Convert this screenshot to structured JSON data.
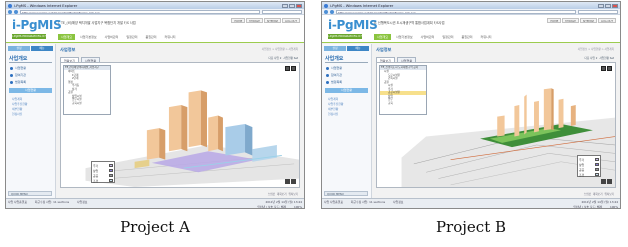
{
  "captions": [
    "Project A",
    "Project B"
  ],
  "browser": {
    "title": "i-PgMS - Windows Internet Explorer",
    "url": "http://www.pgms.net/main/ikimfind/mframe_list.asp"
  },
  "app": {
    "logo": "i-PgMIS",
    "logo_sub": "i-PgMS PROGRAM EG 07",
    "top_links": [
      "HOME",
      "MYPAGE",
      "SITEMAP",
      "LOG-OUT"
    ],
    "nav": [
      "사업개요",
      "사업기본정보",
      "사업비관리",
      "일정관리",
      "품질관리",
      "커뮤니티"
    ]
  },
  "sidebar": {
    "tabs": [
      "설정",
      "메뉴"
    ],
    "heading": "사업개요",
    "links": [
      "사업현황",
      "참여기관",
      "법령목록"
    ],
    "button": "사업현황",
    "subs": [
      "사업계획",
      "사업추진현황",
      "세부현황",
      "현장사진"
    ],
    "quick_menu": "QUICK MENU"
  },
  "panels": [
    {
      "project_title": "I. TE_(비)해양 택지개발 사업지구 복합단지 개발 F/S 사업",
      "page_heading": "사업정보",
      "breadcrumb": "사업정보 > 사업현황 > 사업계획",
      "sub_tabs": [
        "현황보기",
        "사업현황"
      ],
      "toolbar_right": [
        "다음 사업 2",
        "사업현황 Set"
      ],
      "tree_title": "TE_(비)해양택지개발_사업지구",
      "tree": [
        {
          "label": "아파트",
          "level": 1,
          "hl": false
        },
        {
          "label": "1단계",
          "level": 2,
          "hl": false
        },
        {
          "label": "2단계",
          "level": 2,
          "hl": false
        },
        {
          "label": "행정",
          "level": 1,
          "hl": false
        },
        {
          "label": "주거동",
          "level": 2,
          "hl": false
        },
        {
          "label": "상가",
          "level": 2,
          "hl": false
        },
        {
          "label": "공원",
          "level": 1,
          "hl": false
        },
        {
          "label": "상업시설",
          "level": 2,
          "hl": false
        },
        {
          "label": "업무시설",
          "level": 2,
          "hl": false
        },
        {
          "label": "교육시설",
          "level": 2,
          "hl": false
        }
      ],
      "legend": [
        {
          "label": "주거",
          "color": "#c6b8e3"
        },
        {
          "label": "상업",
          "color": "#8c7fd6"
        },
        {
          "label": "공공",
          "color": "#9b9b9b"
        },
        {
          "label": "조경",
          "color": "#c8e0ef"
        }
      ],
      "view_footer": [
        "스냅샷",
        "대화보기",
        "위치보기"
      ],
      "status_left": "사업 사업총괄표",
      "status_mid": "최근수정 사업: 11 sections",
      "status_right": "사업정보",
      "status_bottom_mid": "2011년 2월 14일 (월) 13:44",
      "status_bottom_right": "인터넷 | 보호 모드: 해제",
      "zoom": "100%"
    },
    {
      "project_title": "II. 신행복도시권 도시재생구역 통합사업계획 F/S사업",
      "page_heading": "사업정보",
      "breadcrumb": "사업정보 > 사업현황 > 사업계획",
      "sub_tabs": [
        "현황보기",
        "사업현황"
      ],
      "toolbar_right": [
        "다음 사업 2",
        "사업현황 Set"
      ],
      "tree_title": "TE_신행복도시 도시재생구역 공사",
      "tree": [
        {
          "label": "시설",
          "level": 1,
          "hl": false
        },
        {
          "label": "도로시설물",
          "level": 2,
          "hl": false
        },
        {
          "label": "건축시설",
          "level": 2,
          "hl": false
        },
        {
          "label": "공원",
          "level": 1,
          "hl": false
        },
        {
          "label": "시설",
          "level": 2,
          "hl": false
        },
        {
          "label": "주거",
          "level": 2,
          "hl": false
        },
        {
          "label": "공공시설물",
          "level": 2,
          "hl": true
        },
        {
          "label": "상업",
          "level": 2,
          "hl": false
        },
        {
          "label": "업무",
          "level": 2,
          "hl": false
        },
        {
          "label": "교육",
          "level": 2,
          "hl": false
        }
      ],
      "legend": [
        {
          "label": "주거",
          "color": "#c6b8e3"
        },
        {
          "label": "상업",
          "color": "#8c7fd6"
        },
        {
          "label": "공공",
          "color": "#9b9b9b"
        },
        {
          "label": "조경",
          "color": "#c8e0ef"
        }
      ],
      "view_footer": [
        "스냅샷",
        "대화보기",
        "위치보기"
      ],
      "status_left": "사업 사업총괄표",
      "status_mid": "최근수정 사업: 11 sections",
      "status_right": "사업정보",
      "status_bottom_mid": "2011년 2월 14일 (월) 13:44",
      "status_bottom_right": "인터넷 | 보호 모드: 해제",
      "zoom": "100%"
    }
  ]
}
